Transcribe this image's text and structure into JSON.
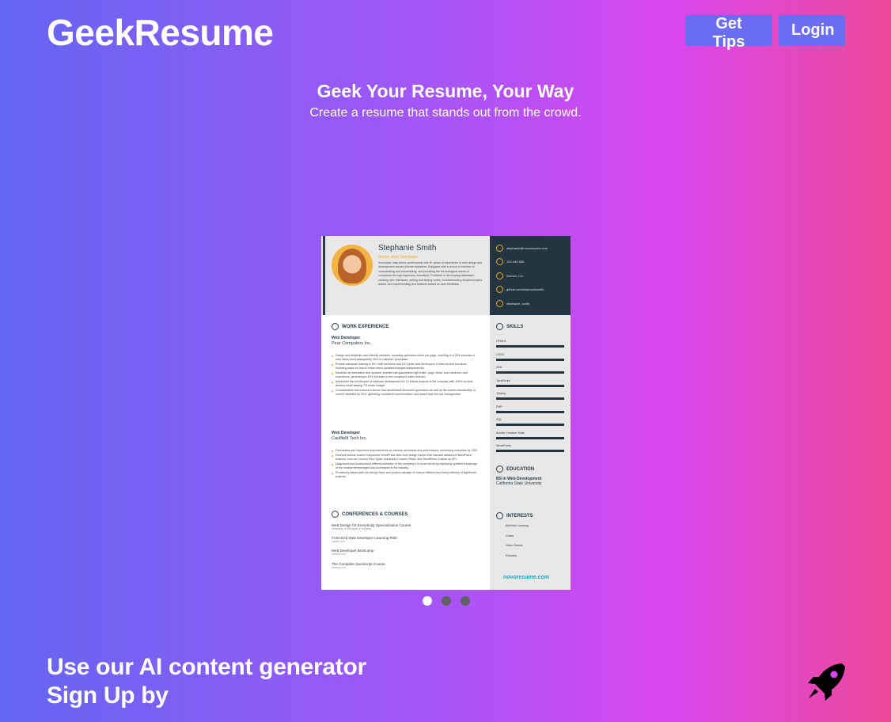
{
  "header": {
    "logo": "GeekResume",
    "tips_label": "Get Tips",
    "login_label": "Login"
  },
  "hero": {
    "title": "Geek Your Resume, Your Way",
    "subtitle": "Create a resume that stands out from the crowd."
  },
  "carousel": {
    "slide_count": 3,
    "active_index": 0,
    "resume": {
      "name": "Stephanie Smith",
      "role": "Senior Web Developer",
      "summary": "Innovative, task-driven professional with 8+ years of experience in web design and development across diverse industries. Equipped with a record of success in consolidating and streamlining, and providing the technological needs of companies through ingenious innovation. Proficient in developing databases, creating user interfaces, writing and testing codes, troubleshooting simple/complex issues, and implementing new features based on user feedback.",
      "contacts": [
        "stephanie@novoresume.com",
        "123 444 555",
        "Denver, CO",
        "github.com/stephaniesmith",
        "stephanie_smith"
      ],
      "sections": {
        "work": "WORK EXPERIENCE",
        "skills": "SKILLS",
        "education": "EDUCATION",
        "interests": "INTERESTS",
        "conferences": "CONFERENCES & COURSES"
      },
      "jobs": [
        {
          "title": "Web Developer",
          "company": "Pear Computers Inc.",
          "bullets": [
            "Design and establish user-friendly websites, including optimized check-out page, resulting in a 25% increase in user clicks and subsequently 33% in customer purchases.",
            "Provide adequate training to 60+ staff members and 23+ junior web developers in internal web functions, including steps on how to make minor updates/changes independently.",
            "Establish an interactive and dynamic website that guarantees high traffic, page views, and maximum user experience, generating a 43% increase in the company's sales revenue.",
            "Administer the full lifecycle of software development for 12 critical projects of the company with 100% on-time delivery while staying 7% under budget.",
            "Conceptualize and enforce a server that accelerated document generation as well as the search-functionality of current websites by 15%, garnering consistent commendation and award from the top management."
          ]
        },
        {
          "title": "Web Developer",
          "company": "Caulfield Tech Inc.",
          "bullets": [
            "Formulated and implement improvements on cleanup processes and performance, minimizing downtime by 15%.",
            "Devised various custom responsive WordPress sites from design comps that included advanced WordPress features, such as Custom Post Types, Advanced Custom Fields, and WordPress Custom as API.",
            "Diagnosed and troubleshoot different websites of the company's or local clients by deploying updated knowledge of the modern technologies and techniques in the industry.",
            "Proactively liaised with the design team and project manager to ensure efficient and timely delivery of significant projects."
          ]
        }
      ],
      "skills": [
        "HTML5",
        "CSS3",
        "XML",
        "JavaScript",
        "JQuery",
        "PHP",
        "SQL",
        "Adobe Creative Suite",
        "WordPress"
      ],
      "education": {
        "degree": "BS in Web Development",
        "school": "California State University"
      },
      "interests": [
        "Machine Learning",
        "Chess",
        "Video Games",
        "Robotics"
      ],
      "courses": [
        {
          "name": "Web Design for Everybody Specialization Course",
          "org": "University of Michigan (Coursera)"
        },
        {
          "name": "Front End Web Developer Learning Path",
          "org": "Lynda.com"
        },
        {
          "name": "Web Developer Bootcamp",
          "org": "Udemy.com"
        },
        {
          "name": "The Complete JavaScript Course",
          "org": "Udemy.com"
        }
      ],
      "brand": "novoresume.com"
    }
  },
  "footer": {
    "line1": "Use our AI content generator",
    "line2": "Sign Up by"
  },
  "icons": {
    "rocket": "rocket-icon"
  }
}
